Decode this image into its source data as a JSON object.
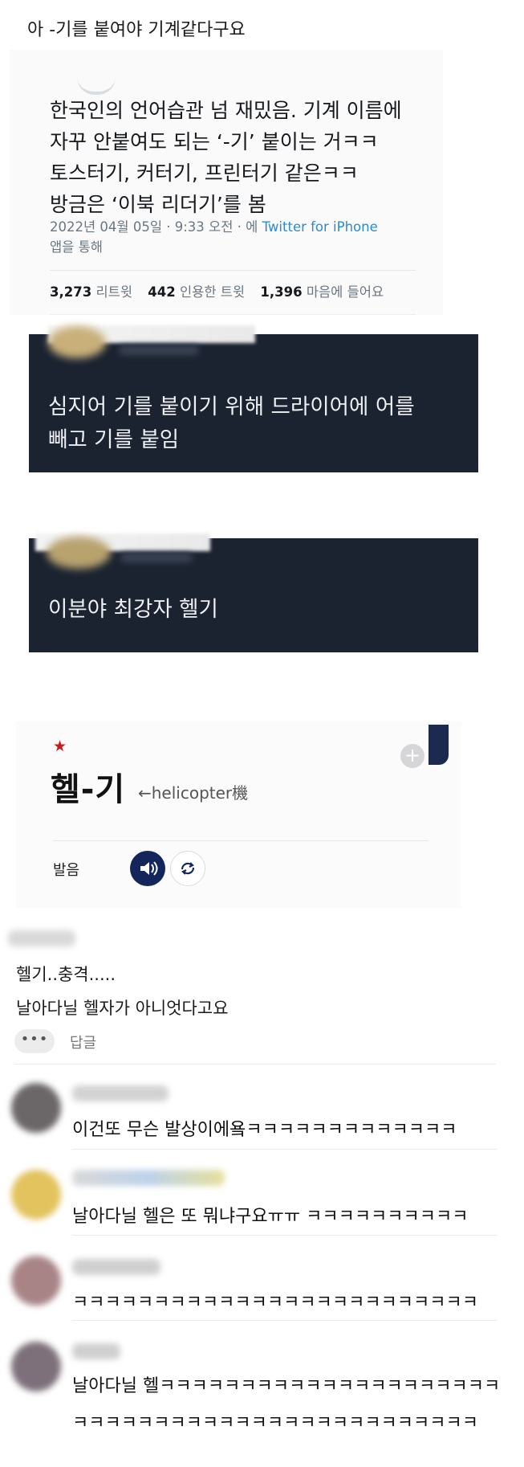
{
  "intro": {
    "text": "아 -기를 붙여야 기계같다구요"
  },
  "tweet": {
    "text": "한국인의 언어습관 넘 재밌음. 기계 이름에\n자꾸 안붙여도 되는 ‘-기’ 붙이는 거ㅋㅋ\n토스터기, 커터기, 프린터기 같은ㅋㅋ\n방금은 ‘이북 리더기’를 봄",
    "date": "2022년 04월 05일 · 9:33 오전 · 에 ",
    "via": "Twitter for iPhone",
    "via_suffix": "앱을 통해",
    "retweets_count": "3,273",
    "retweets_label": "리트윗",
    "quotes_count": "442",
    "quotes_label": "인용한 트윗",
    "likes_count": "1,396",
    "likes_label": "마음에 들어요"
  },
  "reply_cards": [
    {
      "text": "심지어 기를 붙이기 위해 드라이어에 어를\n빼고 기를 붙임"
    },
    {
      "text": "이분야 최강자 헬기"
    }
  ],
  "dictionary": {
    "star": "★",
    "word": "헬-기",
    "origin": "←helicopter機",
    "pronunciation_label": "발음",
    "icons": {
      "add": "plus-icon",
      "bookmark": "bookmark-icon",
      "play": "speaker-icon",
      "repeat": "repeat-icon"
    },
    "colors": {
      "star": "#cc1a1a",
      "speaker_bg": "#13265c"
    }
  },
  "comment": {
    "lines": [
      "헬기..충격.....",
      "날아다닐 헬자가 아니엇다고요"
    ],
    "more_label": "•••",
    "reply_label": "답글"
  },
  "replies": [
    {
      "text": "이건또 무슨 발상이에욬ㅋㅋㅋㅋㅋㅋㅋㅋㅋㅋㅋㅋㅋ"
    },
    {
      "text": "날아다닐 헬은 또 뭐냐구요ㅠㅠ ㅋㅋㅋㅋㅋㅋㅋㅋㅋㅋ"
    },
    {
      "text": "ㅋㅋㅋㅋㅋㅋㅋㅋㅋㅋㅋㅋㅋㅋㅋㅋㅋㅋㅋㅋㅋㅋㅋㅋㅋ"
    },
    {
      "text": "날아다닐 헬ㅋㅋㅋㅋㅋㅋㅋㅋㅋㅋㅋㅋㅋㅋㅋㅋㅋㅋㅋㅋㅋ",
      "text2": "ㅋㅋㅋㅋㅋㅋㅋㅋㅋㅋㅋㅋㅋㅋㅋㅋㅋㅋㅋㅋㅋㅋㅋㅋㅋ"
    }
  ],
  "colors": {
    "dark_card": "#1b2331",
    "link": "#2a8bd4"
  }
}
